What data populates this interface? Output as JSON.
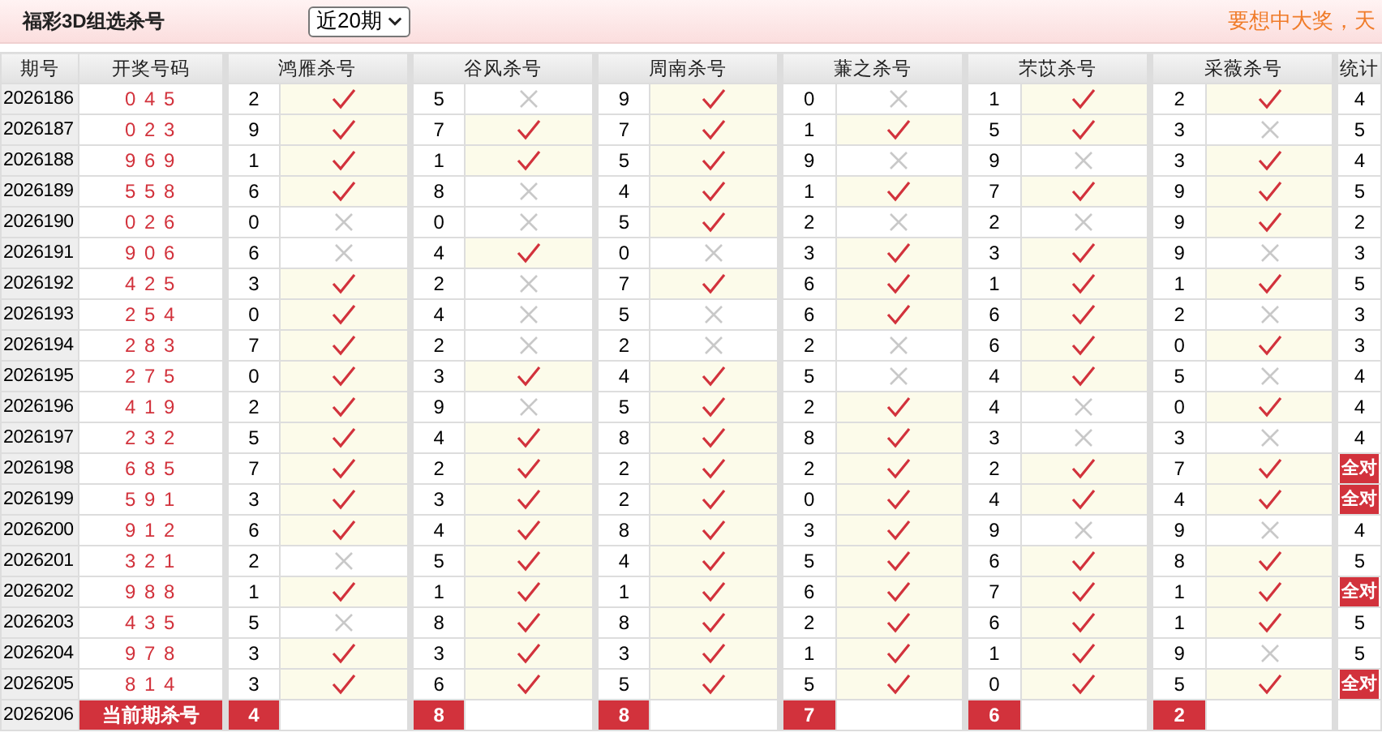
{
  "header": {
    "title": "福彩3D组选杀号",
    "period_select": "近20期",
    "slogan": "要想中大奖，天"
  },
  "table": {
    "columns": [
      "期号",
      "开奖号码",
      "鸿雁杀号",
      "谷风杀号",
      "周南杀号",
      "蒹之杀号",
      "芣苡杀号",
      "采薇杀号",
      "统计"
    ],
    "rows": [
      {
        "period": "2026186",
        "draw": "0 4 5",
        "kills": [
          {
            "number": "2",
            "hit": true
          },
          {
            "number": "5",
            "hit": false
          },
          {
            "number": "9",
            "hit": true
          },
          {
            "number": "0",
            "hit": false
          },
          {
            "number": "1",
            "hit": true
          },
          {
            "number": "2",
            "hit": true
          }
        ],
        "stat": "4",
        "all_correct": false
      },
      {
        "period": "2026187",
        "draw": "0 2 3",
        "kills": [
          {
            "number": "9",
            "hit": true
          },
          {
            "number": "7",
            "hit": true
          },
          {
            "number": "7",
            "hit": true
          },
          {
            "number": "1",
            "hit": true
          },
          {
            "number": "5",
            "hit": true
          },
          {
            "number": "3",
            "hit": false
          }
        ],
        "stat": "5",
        "all_correct": false
      },
      {
        "period": "2026188",
        "draw": "9 6 9",
        "kills": [
          {
            "number": "1",
            "hit": true
          },
          {
            "number": "1",
            "hit": true
          },
          {
            "number": "5",
            "hit": true
          },
          {
            "number": "9",
            "hit": false
          },
          {
            "number": "9",
            "hit": false
          },
          {
            "number": "3",
            "hit": true
          }
        ],
        "stat": "4",
        "all_correct": false
      },
      {
        "period": "2026189",
        "draw": "5 5 8",
        "kills": [
          {
            "number": "6",
            "hit": true
          },
          {
            "number": "8",
            "hit": false
          },
          {
            "number": "4",
            "hit": true
          },
          {
            "number": "1",
            "hit": true
          },
          {
            "number": "7",
            "hit": true
          },
          {
            "number": "9",
            "hit": true
          }
        ],
        "stat": "5",
        "all_correct": false
      },
      {
        "period": "2026190",
        "draw": "0 2 6",
        "kills": [
          {
            "number": "0",
            "hit": false
          },
          {
            "number": "0",
            "hit": false
          },
          {
            "number": "5",
            "hit": true
          },
          {
            "number": "2",
            "hit": false
          },
          {
            "number": "2",
            "hit": false
          },
          {
            "number": "9",
            "hit": true
          }
        ],
        "stat": "2",
        "all_correct": false
      },
      {
        "period": "2026191",
        "draw": "9 0 6",
        "kills": [
          {
            "number": "6",
            "hit": false
          },
          {
            "number": "4",
            "hit": true
          },
          {
            "number": "0",
            "hit": false
          },
          {
            "number": "3",
            "hit": true
          },
          {
            "number": "3",
            "hit": true
          },
          {
            "number": "9",
            "hit": false
          }
        ],
        "stat": "3",
        "all_correct": false
      },
      {
        "period": "2026192",
        "draw": "4 2 5",
        "kills": [
          {
            "number": "3",
            "hit": true
          },
          {
            "number": "2",
            "hit": false
          },
          {
            "number": "7",
            "hit": true
          },
          {
            "number": "6",
            "hit": true
          },
          {
            "number": "1",
            "hit": true
          },
          {
            "number": "1",
            "hit": true
          }
        ],
        "stat": "5",
        "all_correct": false
      },
      {
        "period": "2026193",
        "draw": "2 5 4",
        "kills": [
          {
            "number": "0",
            "hit": true
          },
          {
            "number": "4",
            "hit": false
          },
          {
            "number": "5",
            "hit": false
          },
          {
            "number": "6",
            "hit": true
          },
          {
            "number": "6",
            "hit": true
          },
          {
            "number": "2",
            "hit": false
          }
        ],
        "stat": "3",
        "all_correct": false
      },
      {
        "period": "2026194",
        "draw": "2 8 3",
        "kills": [
          {
            "number": "7",
            "hit": true
          },
          {
            "number": "2",
            "hit": false
          },
          {
            "number": "2",
            "hit": false
          },
          {
            "number": "2",
            "hit": false
          },
          {
            "number": "6",
            "hit": true
          },
          {
            "number": "0",
            "hit": true
          }
        ],
        "stat": "3",
        "all_correct": false
      },
      {
        "period": "2026195",
        "draw": "2 7 5",
        "kills": [
          {
            "number": "0",
            "hit": true
          },
          {
            "number": "3",
            "hit": true
          },
          {
            "number": "4",
            "hit": true
          },
          {
            "number": "5",
            "hit": false
          },
          {
            "number": "4",
            "hit": true
          },
          {
            "number": "5",
            "hit": false
          }
        ],
        "stat": "4",
        "all_correct": false
      },
      {
        "period": "2026196",
        "draw": "4 1 9",
        "kills": [
          {
            "number": "2",
            "hit": true
          },
          {
            "number": "9",
            "hit": false
          },
          {
            "number": "5",
            "hit": true
          },
          {
            "number": "2",
            "hit": true
          },
          {
            "number": "4",
            "hit": false
          },
          {
            "number": "0",
            "hit": true
          }
        ],
        "stat": "4",
        "all_correct": false
      },
      {
        "period": "2026197",
        "draw": "2 3 2",
        "kills": [
          {
            "number": "5",
            "hit": true
          },
          {
            "number": "4",
            "hit": true
          },
          {
            "number": "8",
            "hit": true
          },
          {
            "number": "8",
            "hit": true
          },
          {
            "number": "3",
            "hit": false
          },
          {
            "number": "3",
            "hit": false
          }
        ],
        "stat": "4",
        "all_correct": false
      },
      {
        "period": "2026198",
        "draw": "6 8 5",
        "kills": [
          {
            "number": "7",
            "hit": true
          },
          {
            "number": "2",
            "hit": true
          },
          {
            "number": "2",
            "hit": true
          },
          {
            "number": "2",
            "hit": true
          },
          {
            "number": "2",
            "hit": true
          },
          {
            "number": "7",
            "hit": true
          }
        ],
        "stat": "全对",
        "all_correct": true
      },
      {
        "period": "2026199",
        "draw": "5 9 1",
        "kills": [
          {
            "number": "3",
            "hit": true
          },
          {
            "number": "3",
            "hit": true
          },
          {
            "number": "2",
            "hit": true
          },
          {
            "number": "0",
            "hit": true
          },
          {
            "number": "4",
            "hit": true
          },
          {
            "number": "4",
            "hit": true
          }
        ],
        "stat": "全对",
        "all_correct": true
      },
      {
        "period": "2026200",
        "draw": "9 1 2",
        "kills": [
          {
            "number": "6",
            "hit": true
          },
          {
            "number": "4",
            "hit": true
          },
          {
            "number": "8",
            "hit": true
          },
          {
            "number": "3",
            "hit": true
          },
          {
            "number": "9",
            "hit": false
          },
          {
            "number": "9",
            "hit": false
          }
        ],
        "stat": "4",
        "all_correct": false
      },
      {
        "period": "2026201",
        "draw": "3 2 1",
        "kills": [
          {
            "number": "2",
            "hit": false
          },
          {
            "number": "5",
            "hit": true
          },
          {
            "number": "4",
            "hit": true
          },
          {
            "number": "5",
            "hit": true
          },
          {
            "number": "6",
            "hit": true
          },
          {
            "number": "8",
            "hit": true
          }
        ],
        "stat": "5",
        "all_correct": false
      },
      {
        "period": "2026202",
        "draw": "9 8 8",
        "kills": [
          {
            "number": "1",
            "hit": true
          },
          {
            "number": "1",
            "hit": true
          },
          {
            "number": "1",
            "hit": true
          },
          {
            "number": "6",
            "hit": true
          },
          {
            "number": "7",
            "hit": true
          },
          {
            "number": "1",
            "hit": true
          }
        ],
        "stat": "全对",
        "all_correct": true
      },
      {
        "period": "2026203",
        "draw": "4 3 5",
        "kills": [
          {
            "number": "5",
            "hit": false
          },
          {
            "number": "8",
            "hit": true
          },
          {
            "number": "8",
            "hit": true
          },
          {
            "number": "2",
            "hit": true
          },
          {
            "number": "6",
            "hit": true
          },
          {
            "number": "1",
            "hit": true
          }
        ],
        "stat": "5",
        "all_correct": false
      },
      {
        "period": "2026204",
        "draw": "9 7 8",
        "kills": [
          {
            "number": "3",
            "hit": true
          },
          {
            "number": "3",
            "hit": true
          },
          {
            "number": "3",
            "hit": true
          },
          {
            "number": "1",
            "hit": true
          },
          {
            "number": "1",
            "hit": true
          },
          {
            "number": "9",
            "hit": false
          }
        ],
        "stat": "5",
        "all_correct": false
      },
      {
        "period": "2026205",
        "draw": "8 1 4",
        "kills": [
          {
            "number": "3",
            "hit": true
          },
          {
            "number": "6",
            "hit": true
          },
          {
            "number": "5",
            "hit": true
          },
          {
            "number": "5",
            "hit": true
          },
          {
            "number": "0",
            "hit": true
          },
          {
            "number": "5",
            "hit": true
          }
        ],
        "stat": "全对",
        "all_correct": true
      }
    ],
    "current": {
      "period": "2026206",
      "label": "当前期杀号",
      "kills": [
        "4",
        "8",
        "8",
        "7",
        "6",
        "2"
      ]
    }
  }
}
